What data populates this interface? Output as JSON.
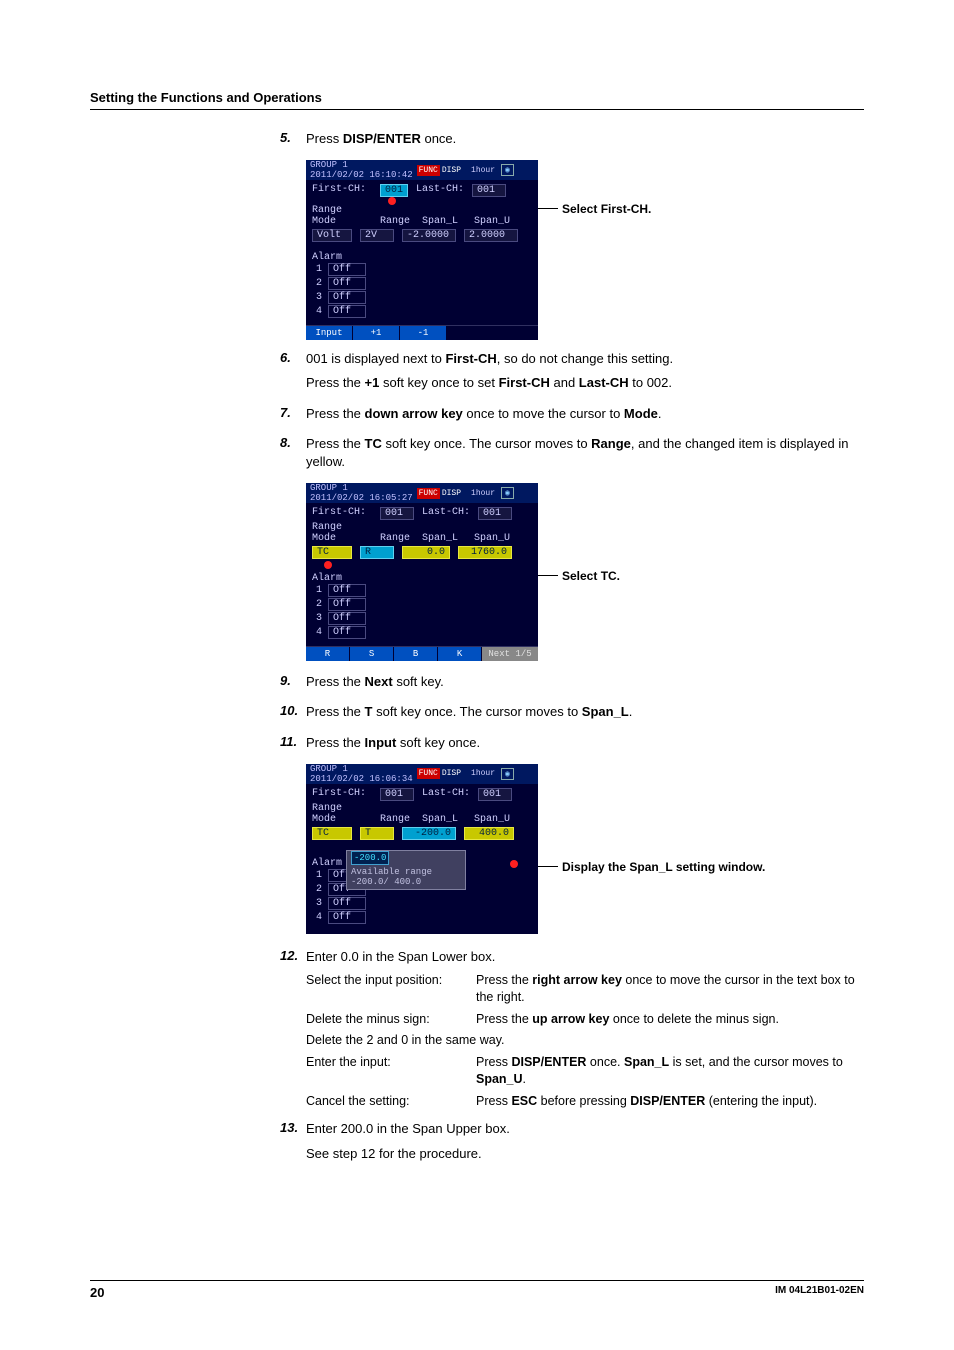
{
  "sectionTitle": "Setting the Functions and Operations",
  "step5": {
    "num": "5.",
    "text1_pre": "Press ",
    "text1_bold": "DISP/ENTER",
    "text1_post": " once.",
    "callout": "Select First-CH."
  },
  "screen5": {
    "group": "GROUP 1",
    "datetime": "2011/02/02 16:10:42",
    "badge": "FUNC",
    "disp": "DISP",
    "timeLabel": "1hour",
    "firstCh": "First-CH:",
    "firstChVal": "001",
    "lastCh": "Last-CH:",
    "lastChVal": "001",
    "rangeLabel": "Range",
    "modeLabel": "Mode",
    "rangeCol": "Range",
    "spanL": "Span_L",
    "spanU": "Span_U",
    "modeVal": "Volt",
    "rangeVal": "2V",
    "spanLVal": "-2.0000",
    "spanUVal": "2.0000",
    "alarm": "Alarm",
    "off": "Off",
    "sk1": "Input",
    "sk2": "+1",
    "sk3": "-1"
  },
  "step6": {
    "num": "6.",
    "line1a": "001 is displayed next to ",
    "line1b": "First-CH",
    "line1c": ", so do not change this setting.",
    "line2a": "Press the ",
    "line2b": "+1",
    "line2c": " soft key once to set ",
    "line2d": "First-CH",
    "line2e": " and ",
    "line2f": "Last-CH",
    "line2g": " to 002."
  },
  "step7": {
    "num": "7.",
    "a": "Press the ",
    "b": "down arrow key",
    "c": " once to move the cursor to ",
    "d": "Mode",
    "e": "."
  },
  "step8": {
    "num": "8.",
    "a": "Press the ",
    "b": "TC",
    "c": " soft key once. The cursor moves to ",
    "d": "Range",
    "e": ", and the changed item is displayed in yellow.",
    "callout": "Select TC."
  },
  "screen8": {
    "datetime": "2011/02/02 16:05:27",
    "modeVal": "TC",
    "rangeVal": "R",
    "spanLVal": "0.0",
    "spanUVal": "1760.0",
    "sk1": "R",
    "sk2": "S",
    "sk3": "B",
    "sk4": "K",
    "sk5": "Next 1/5"
  },
  "step9": {
    "num": "9.",
    "a": "Press the ",
    "b": "Next",
    "c": " soft key."
  },
  "step10": {
    "num": "10.",
    "a": "Press the ",
    "b": "T",
    "c": " soft key once. The cursor moves to ",
    "d": "Span_L",
    "e": "."
  },
  "step11": {
    "num": "11.",
    "a": "Press the ",
    "b": "Input",
    "c": " soft key once.",
    "callout": "Display the Span_L setting window."
  },
  "screen11": {
    "datetime": "2011/02/02 16:06:34",
    "rangeVal": "T",
    "spanLVal": "-200.0",
    "spanUVal": "400.0",
    "popupVal": "-200.0",
    "popupRange": "Available range",
    "popupRange2": "-200.0/   400.0"
  },
  "step12": {
    "num": "12.",
    "title": "Enter 0.0 in the Span Lower box.",
    "r1l": "Select the input position:",
    "r1r_a": "Press the ",
    "r1r_b": "right arrow key",
    "r1r_c": " once to move the cursor in the text box to the right.",
    "r2l": "Delete the minus sign:",
    "r2r_a": "Press the ",
    "r2r_b": "up arrow key",
    "r2r_c": " once to delete the minus sign.",
    "r3": "Delete the 2 and 0 in the same way.",
    "r4l": "Enter the input:",
    "r4r_a": "Press ",
    "r4r_b": "DISP/ENTER",
    "r4r_c": " once. ",
    "r4r_d": "Span_L",
    "r4r_e": " is set, and the cursor moves to ",
    "r4r_f": "Span_U",
    "r4r_g": ".",
    "r5l": "Cancel the setting:",
    "r5r_a": "Press ",
    "r5r_b": "ESC",
    "r5r_c": " before pressing ",
    "r5r_d": "DISP/ENTER",
    "r5r_e": " (entering the input)."
  },
  "step13": {
    "num": "13.",
    "a": "Enter 200.0 in the Span Upper box.",
    "b": "See step 12 for the procedure."
  },
  "footer": {
    "page": "20",
    "doc": "IM 04L21B01-02EN"
  }
}
